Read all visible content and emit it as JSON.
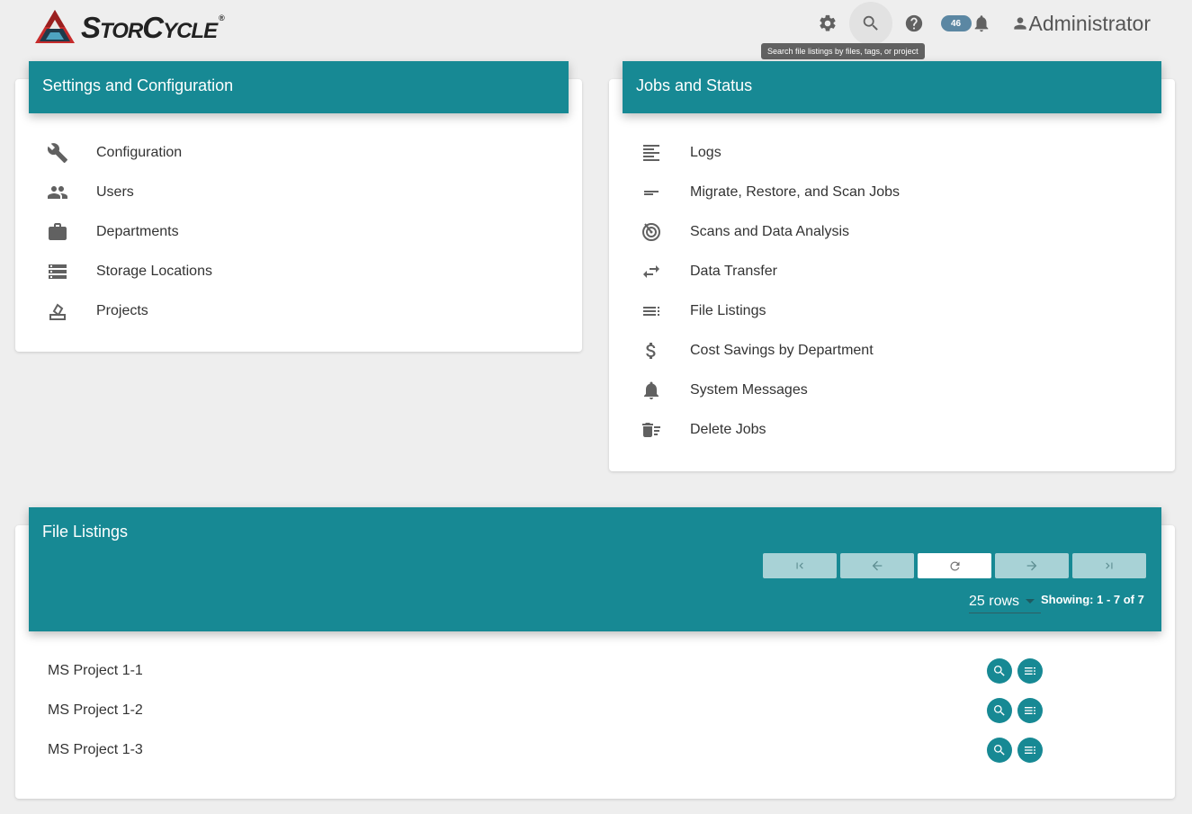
{
  "app": {
    "logo_text_big": "S",
    "logo_text_rest1": "TOR",
    "logo_text_big2": "C",
    "logo_text_rest2": "YCLE",
    "logo_mark": "®"
  },
  "header": {
    "icons": [
      "gear-icon",
      "search-icon",
      "help-icon",
      "bell-icon",
      "person-icon"
    ],
    "notification_count": "46",
    "user_name": "Administrator",
    "tooltip": "Search file listings by files, tags, or project"
  },
  "settings": {
    "title": "Settings and Configuration",
    "items": [
      {
        "label": "Configuration",
        "icon": "wrench-icon"
      },
      {
        "label": "Users",
        "icon": "users-icon"
      },
      {
        "label": "Departments",
        "icon": "briefcase-icon"
      },
      {
        "label": "Storage Locations",
        "icon": "storage-icon"
      },
      {
        "label": "Projects",
        "icon": "projects-icon"
      }
    ]
  },
  "jobs": {
    "title": "Jobs and Status",
    "items": [
      {
        "label": "Logs",
        "icon": "logs-icon"
      },
      {
        "label": "Migrate, Restore, and Scan Jobs",
        "icon": "jobs-icon"
      },
      {
        "label": "Scans and Data Analysis",
        "icon": "radar-icon"
      },
      {
        "label": "Data Transfer",
        "icon": "transfer-icon"
      },
      {
        "label": "File Listings",
        "icon": "file-listings-icon"
      },
      {
        "label": "Cost Savings by Department",
        "icon": "dollar-icon"
      },
      {
        "label": "System Messages",
        "icon": "bell-icon"
      },
      {
        "label": "Delete Jobs",
        "icon": "delete-sweep-icon"
      }
    ]
  },
  "file_listings": {
    "title": "File Listings",
    "pager_buttons": [
      "first-page-icon",
      "prev-page-icon",
      "refresh-icon",
      "next-page-icon",
      "last-page-icon"
    ],
    "rows_per_page": "25 rows",
    "showing": "Showing: 1 - 7 of 7",
    "rows": [
      {
        "name": "MS Project 1-1"
      },
      {
        "name": "MS Project 1-2"
      },
      {
        "name": "MS Project 1-3"
      }
    ]
  },
  "colors": {
    "accent": "#178994",
    "badge": "#5b87a3",
    "background": "#eeeeee"
  }
}
